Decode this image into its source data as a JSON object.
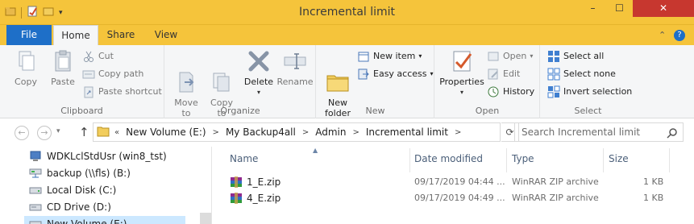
{
  "window": {
    "title": "Incremental limit",
    "minimize": "–",
    "maximize": "☐",
    "close": "✕"
  },
  "ribbon_tabs": {
    "file": "File",
    "home": "Home",
    "share": "Share",
    "view": "View",
    "expand": "⌃",
    "help": "?"
  },
  "clipboard": {
    "label": "Clipboard",
    "copy": "Copy",
    "paste": "Paste",
    "cut": "Cut",
    "copy_path": "Copy path",
    "paste_shortcut": "Paste shortcut"
  },
  "organize": {
    "label": "Organize",
    "move_to": "Move\nto",
    "copy_to": "Copy\nto",
    "delete": "Delete",
    "rename": "Rename"
  },
  "new": {
    "label": "New",
    "new_folder": "New\nfolder",
    "new_item": "New item",
    "easy_access": "Easy access"
  },
  "open": {
    "label": "Open",
    "properties": "Properties",
    "open": "Open",
    "edit": "Edit",
    "history": "History"
  },
  "select": {
    "label": "Select",
    "select_all": "Select all",
    "select_none": "Select none",
    "invert_selection": "Invert selection"
  },
  "address": {
    "prefix": "«",
    "crumbs": [
      "New Volume (E:)",
      "My Backup4all",
      "Admin",
      "Incremental limit"
    ],
    "search_placeholder": "Search Incremental limit"
  },
  "nav_pane": {
    "items": [
      {
        "label": "WDKLclStdUsr (win8_tst)",
        "icon": "computer-icon"
      },
      {
        "label": "backup (\\\\fls) (B:)",
        "icon": "network-drive-icon"
      },
      {
        "label": "Local Disk (C:)",
        "icon": "drive-icon"
      },
      {
        "label": "CD Drive (D:)",
        "icon": "cd-drive-icon"
      },
      {
        "label": "New Volume (E:)",
        "icon": "drive-icon"
      }
    ]
  },
  "columns": {
    "name": "Name",
    "date_modified": "Date modified",
    "type": "Type",
    "size": "Size"
  },
  "files": [
    {
      "name": "1_E.zip",
      "date": "09/17/2019 04:44 ...",
      "type": "WinRAR ZIP archive",
      "size": "1 KB",
      "icon": "winrar-icon"
    },
    {
      "name": "4_E.zip",
      "date": "09/17/2019 04:49 ...",
      "type": "WinRAR ZIP archive",
      "size": "1 KB",
      "icon": "winrar-icon"
    }
  ],
  "colors": {
    "title_bar": "#f5c43b",
    "file_tab": "#1e6fc8",
    "close_button": "#c7372f",
    "column_header": "#4c607a"
  }
}
